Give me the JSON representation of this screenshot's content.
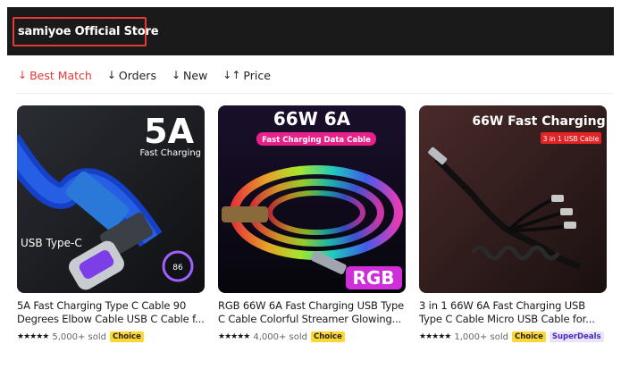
{
  "store": {
    "name": "samiyoe Official Store"
  },
  "sort": {
    "items": [
      {
        "label": "Best Match",
        "arrow": "↓"
      },
      {
        "label": "Orders",
        "arrow": "↓"
      },
      {
        "label": "New",
        "arrow": "↓"
      },
      {
        "label": "Price",
        "arrow": "↓↑"
      }
    ]
  },
  "products": [
    {
      "image_text": {
        "big": "5A",
        "sub": "Fast Charging",
        "type": "USB Type-C",
        "dial": "86"
      },
      "title": "5A Fast Charging Type C Cable 90 Degrees Elbow Cable USB C Cable f...",
      "stars": "★★★★★",
      "sold": "5,000+ sold",
      "badges": [
        "Choice"
      ]
    },
    {
      "image_text": {
        "big": "66W 6A",
        "sub": "Fast Charging Data Cable",
        "rgb": "RGB"
      },
      "title": "RGB 66W 6A Fast Charging USB Type C Cable Colorful Streamer Glowing...",
      "stars": "★★★★★",
      "sold": "4,000+ sold",
      "badges": [
        "Choice"
      ]
    },
    {
      "image_text": {
        "big": "66W Fast Charging",
        "sub": "3 in 1 USB Cable"
      },
      "title": "3 in 1 66W 6A Fast Charging USB Type C Cable Micro USB Cable for...",
      "stars": "★★★★★",
      "sold": "1,000+ sold",
      "badges": [
        "Choice",
        "SuperDeals"
      ]
    }
  ]
}
